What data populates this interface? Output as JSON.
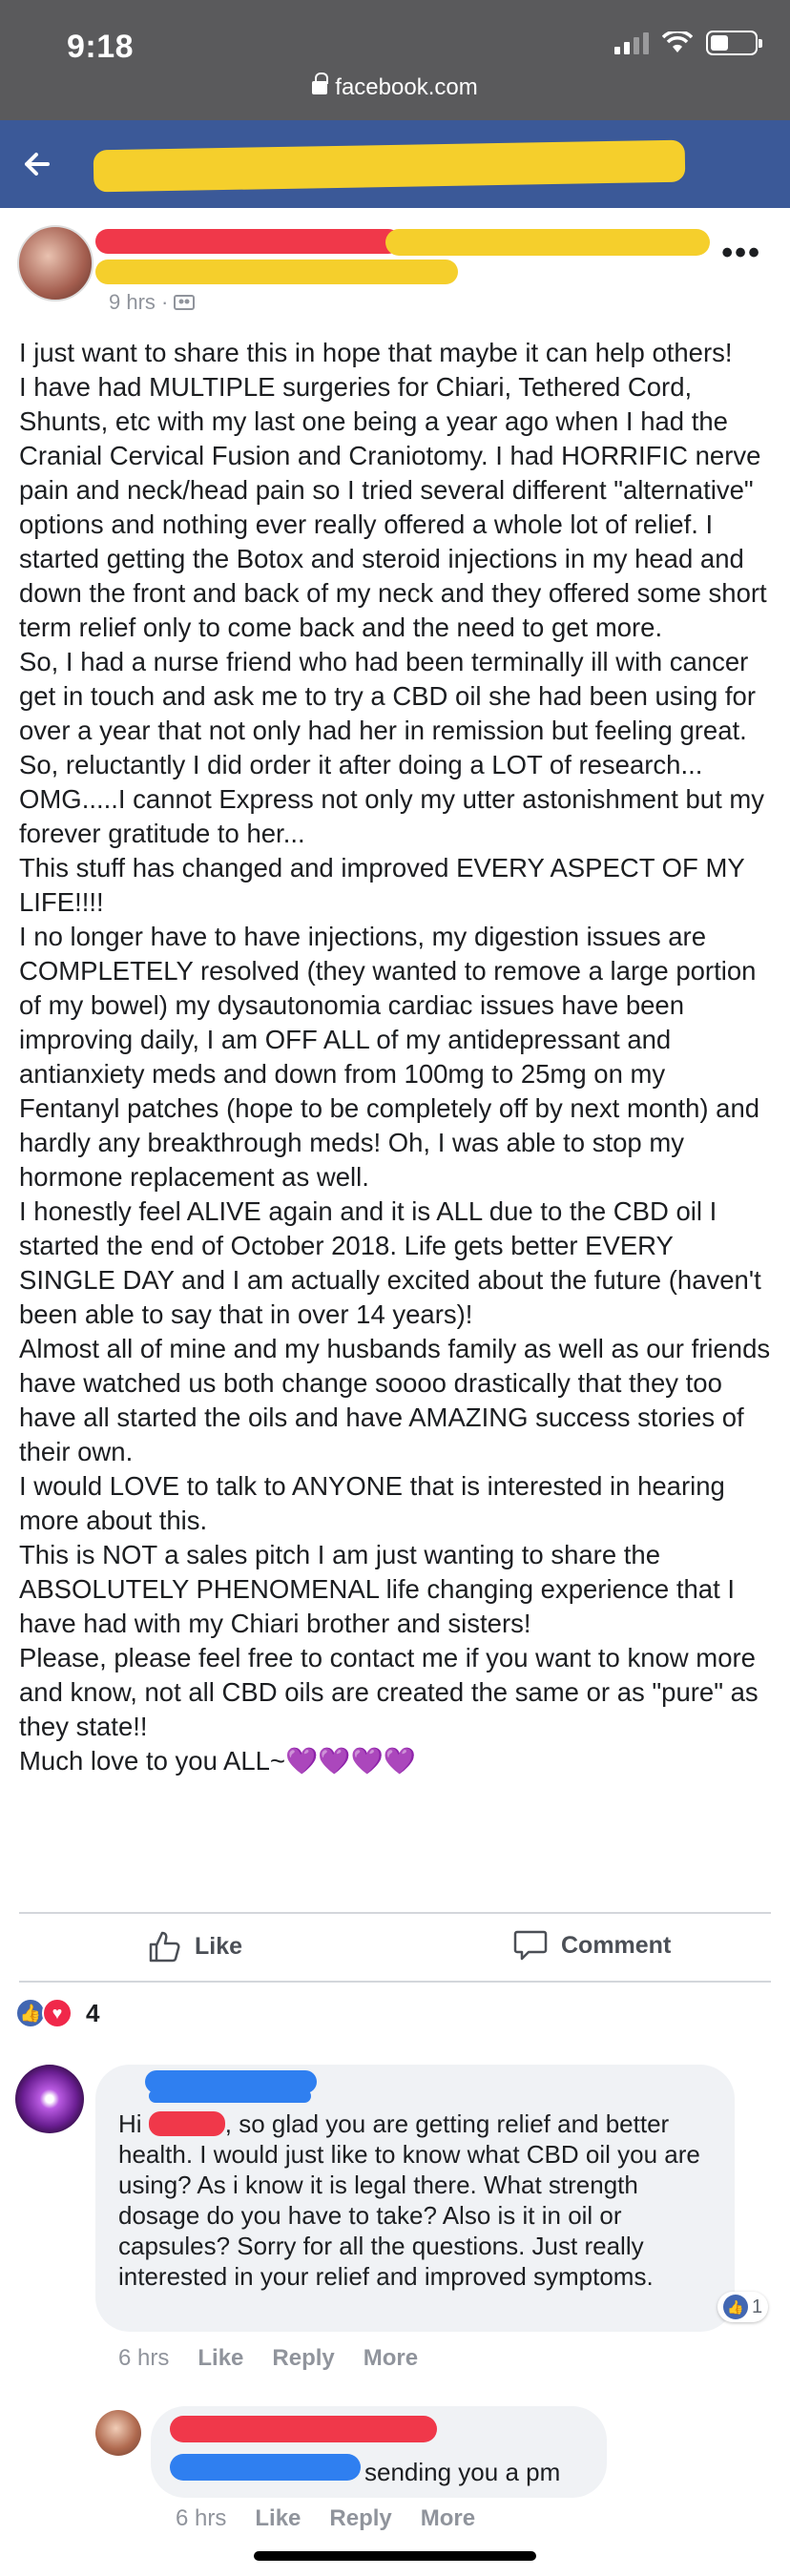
{
  "status_bar": {
    "time": "9:18",
    "url": "facebook.com"
  },
  "post": {
    "meta": "9 hrs · ",
    "body": [
      "I just want to share this in hope that maybe it can help others!",
      "I have had MULTIPLE surgeries for Chiari, Tethered Cord, Shunts, etc with my last one being a year ago when I had the Cranial Cervical Fusion and Craniotomy. I had HORRIFIC nerve pain and neck/head pain so I tried several different \"alternative\" options and nothing ever really offered a whole lot of relief. I started getting the Botox and steroid injections in my head and down the front and back of my neck and they offered some short term relief only to come back and the need to get more.",
      "So, I had a nurse friend who had been terminally ill with cancer get in touch and ask me to try a CBD oil she had been using for over a year that not only had her in remission but feeling great.",
      "So, reluctantly I did order it after doing a LOT of research... OMG.....I cannot Express not only my utter astonishment but my forever gratitude to her...",
      "This stuff has changed and improved EVERY ASPECT OF MY LIFE!!!!",
      "I no longer have to have injections, my digestion issues are COMPLETELY resolved (they wanted to remove a large portion of my bowel) my dysautonomia cardiac issues have been improving daily, I am OFF ALL of my antidepressant and antianxiety meds and down from 100mg to 25mg on my Fentanyl patches (hope to be completely off by next month) and hardly any breakthrough meds! Oh, I was able to stop my hormone replacement as well.",
      "I honestly feel ALIVE again and it is ALL due to the CBD oil I started the end of October 2018. Life gets better EVERY SINGLE DAY and I am actually excited about the future (haven't been able to say that in over 14 years)!",
      "Almost all of mine and my husbands family as well as our friends have watched us both change soooo drastically that they too have all started the oils and have AMAZING success stories of their own.",
      "I would LOVE to talk to ANYONE that is interested in hearing more about this.",
      "This is NOT a sales pitch I am just wanting to share the ABSOLUTELY PHENOMENAL life changing experience that I have had with my Chiari brother and sisters!",
      "Please, please feel free to contact me if you want to know more and know, not all CBD oils are created the same or as \"pure\" as they state!!",
      "Much love to you ALL~"
    ],
    "hearts": "💜💜💜💜",
    "like_label": "Like",
    "comment_label": "Comment",
    "reaction_count": "4"
  },
  "comments": [
    {
      "text_prefix": "Hi",
      "text_rest": ", so glad you are getting relief and better health. I would just like to know what CBD oil you are using? As i know it is legal there. What strength dosage do you have to take? Also is it in oil or capsules? Sorry for all the questions. Just really interested in your relief and improved symptoms.",
      "likes": "1",
      "time": "6 hrs",
      "like": "Like",
      "reply": "Reply",
      "more": "More"
    },
    {
      "text": "sending you a pm",
      "time": "6 hrs",
      "like": "Like",
      "reply": "Reply",
      "more": "More"
    }
  ],
  "colors": {
    "facebook_blue": "#3b5998",
    "redaction_yellow": "#f5cf2c",
    "redaction_red": "#f0384a",
    "redaction_blue": "#2f7ff0"
  }
}
